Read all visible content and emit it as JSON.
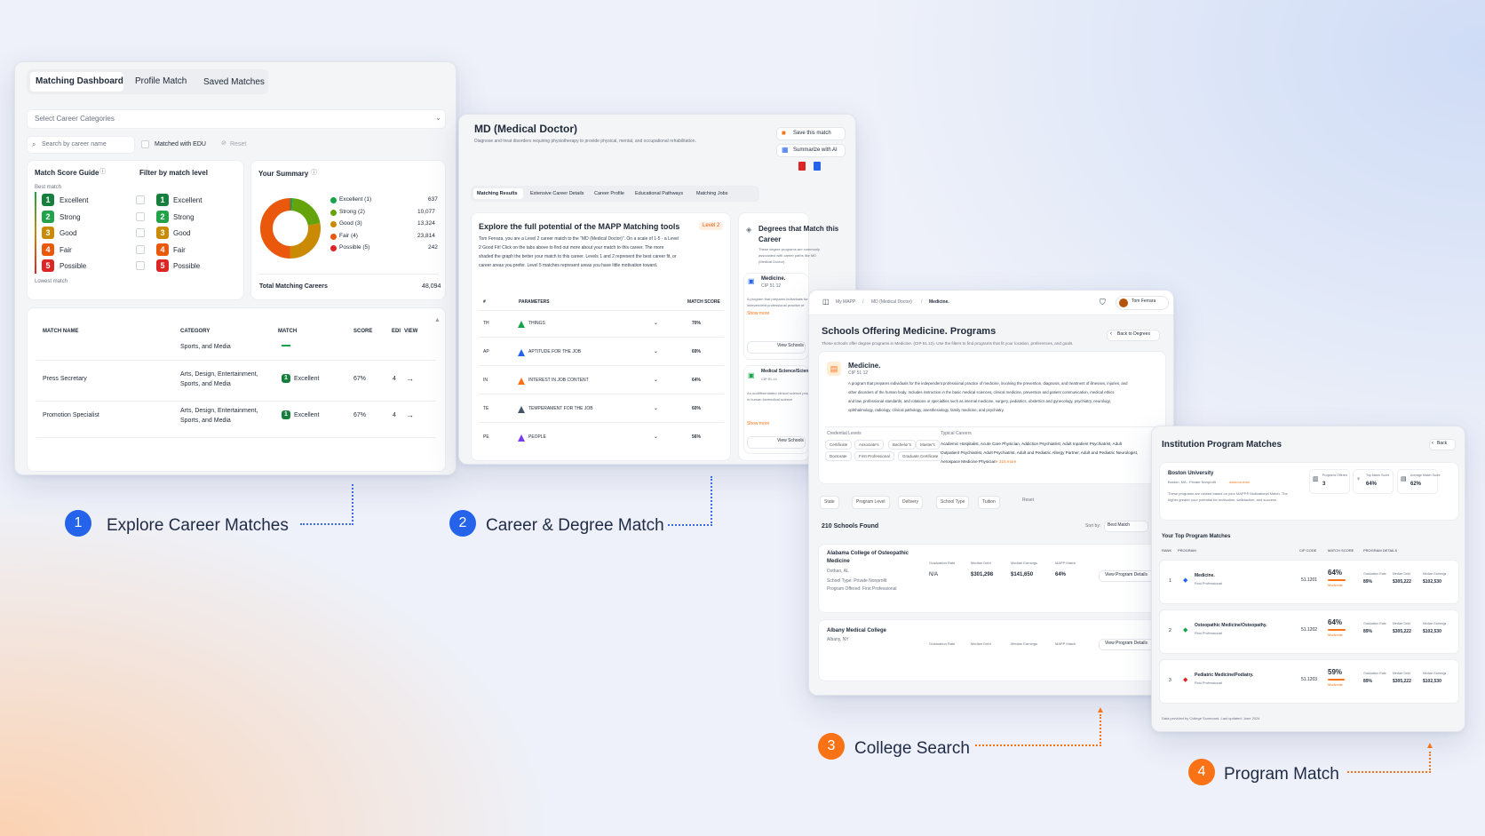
{
  "panel1": {
    "tabs": [
      "Matching Dashboard",
      "Profile Match",
      "Saved Matches"
    ],
    "select_placeholder": "Select Career Categories",
    "search_placeholder": "Search by career name",
    "checkbox_label": "Matched with EDU",
    "reset_label": "Reset",
    "guide_title": "Match Score Guide",
    "guide_top": "Best match",
    "guide_bottom": "Lowest match",
    "filter_title": "Filter by match level",
    "levels": [
      {
        "num": "1",
        "label": "Excellent",
        "color": "#15803d"
      },
      {
        "num": "2",
        "label": "Strong",
        "color": "#22a34a"
      },
      {
        "num": "3",
        "label": "Good",
        "color": "#ca8a04"
      },
      {
        "num": "4",
        "label": "Fair",
        "color": "#ea580c"
      },
      {
        "num": "5",
        "label": "Possible",
        "color": "#dc2626"
      }
    ],
    "summary_title": "Your Summary",
    "summary": [
      {
        "label": "Excellent (1)",
        "value": "637",
        "color": "#16a34a"
      },
      {
        "label": "Strong (2)",
        "value": "10,077",
        "color": "#65a30d"
      },
      {
        "label": "Good (3)",
        "value": "13,324",
        "color": "#ca8a04"
      },
      {
        "label": "Fair (4)",
        "value": "23,814",
        "color": "#ea580c"
      },
      {
        "label": "Possible (5)",
        "value": "242",
        "color": "#dc2626"
      }
    ],
    "total_label": "Total Matching Careers",
    "total_value": "48,094",
    "table_headers": [
      "MATCH NAME",
      "CATEGORY",
      "MATCH",
      "SCORE",
      "EDI",
      "VIEW"
    ],
    "row0_category": "Sports, and Media",
    "rows": [
      {
        "name": "Press Secretary",
        "cat1": "Arts, Design, Entertainment,",
        "cat2": "Sports, and Media",
        "num": "1",
        "match": "Excellent",
        "score": "67%",
        "edu": "4"
      },
      {
        "name": "Promotion Specialist",
        "cat1": "Arts, Design, Entertainment,",
        "cat2": "Sports, and Media",
        "num": "1",
        "match": "Excellent",
        "score": "67%",
        "edu": "4"
      }
    ]
  },
  "panel2": {
    "title": "MD (Medical Doctor)",
    "subtitle": "Diagnose and treat disorders requiring physiotherapy to provide physical, mental, and occupational rehabilitation.",
    "save_label": "Save this match",
    "ai_label": "Summarize with AI",
    "tabs": [
      "Matching Results",
      "Extensive Career Details",
      "Career Profile",
      "Educational Pathways",
      "Matching Jobs"
    ],
    "explore_title": "Explore the full potential of the MAPP Matching tools",
    "level_badge": "Level 2",
    "explore_text": [
      "Tom Ferrara, you are a Level 2 career match to the \"MD (Medical Doctor)\". On a scale of 1-5 - a Level",
      "2 Good Fit! Click on the tabs above to find out more about your match to this career. The more",
      "shaded the graph the better your match to this career. Levels 1 and 2 represent the best career fit, or",
      "career areas you prefer. Level 5 matches represent areas you have little motivation toward."
    ],
    "param_headers": [
      "#",
      "PARAMETERS",
      "MATCH SCORE"
    ],
    "params": [
      {
        "code": "TH",
        "name": "THINGS",
        "score": "70%",
        "color": "#16a34a"
      },
      {
        "code": "AP",
        "name": "APTITUDE FOR THE JOB",
        "score": "69%",
        "color": "#2563eb"
      },
      {
        "code": "IN",
        "name": "INTEREST IN JOB CONTENT",
        "score": "64%",
        "color": "#f97316"
      },
      {
        "code": "TE",
        "name": "TEMPERAMENT FOR THE JOB",
        "score": "60%",
        "color": "#475569"
      },
      {
        "code": "PE",
        "name": "PEOPLE",
        "score": "56%",
        "color": "#7c3aed"
      }
    ],
    "degrees_title1": "Degrees that Match this",
    "degrees_title2": "Career",
    "degrees_desc": [
      "These degree programs are commonly",
      "associated with career paths like MD",
      "(Medical Doctor)."
    ],
    "deg1_name": "Medicine.",
    "deg1_code": "CIP 51.12",
    "deg1_desc": [
      "A program that prepares individuals for",
      "independent professional practice of"
    ],
    "show_more": "Show more",
    "view_schools": "View Schools",
    "deg2_name": "Medical Science/Scientist.",
    "deg2_code": "CIP 51.14",
    "deg2_desc": [
      "An undifferentiated clinical science program",
      "in human biomedical science"
    ]
  },
  "panel3": {
    "breadcrumb": [
      "My MAPP",
      "MD (Medical Doctor)",
      "Medicine."
    ],
    "user": "Tom Ferrara",
    "title": "Schools Offering Medicine. Programs",
    "back": "Back to Degrees",
    "subtitle": "These schools offer degree programs in Medicine. (CIP 51.12). Use the filters to find programs that fit your location, preferences, and goals.",
    "program_name": "Medicine.",
    "program_code": "CIP 51.12",
    "program_desc": [
      "A program that prepares individuals for the independent professional practice of medicine, involving the prevention, diagnosis, and treatment of illnesses, injuries, and",
      "other disorders of the human body. Includes instruction in the basic medical sciences, clinical medicine, prevention and patient communication, medical ethics",
      "and law, professional standards, and rotations or specialties such as internal medicine, surgery, pediatrics, obstetrics and gynecology, psychiatry, neurology,",
      "ophthalmology, radiology, clinical pathology, anesthesiology, family medicine, and psychiatry."
    ],
    "cred_title": "Credential Levels",
    "creds": [
      "Certificate",
      "Associate's",
      "Bachelor's",
      "Master's",
      "Doctorate",
      "First Professional",
      "Graduate Certificate"
    ],
    "careers_title": "Typical Careers",
    "careers": [
      "Academic Hospitalist, Acute Care Physician, Addiction Psychiatrist, Adult Inpatient Psychiatrist, Adult",
      "Outpatient Psychiatrist, Adult Psychiatrist, Adult and Pediatric Allergy Partner, Adult and Pediatric Neurologist,",
      "Aerospace Medicine Physician"
    ],
    "careers_more": "+ 215 more",
    "filters": [
      "State",
      "Program Level",
      "Delivery",
      "School Type",
      "Tuition"
    ],
    "reset": "Reset",
    "found": "210 Schools Found",
    "sort_label": "Sort by:",
    "sort_value": "Best Match",
    "school1": {
      "name1": "Alabama College of Osteopathic",
      "name2": "Medicine",
      "loc": "Dothan, AL",
      "type": "School Type: Private Nonprofit",
      "offered": "Program Offered: First Professional",
      "grad_label": "Graduation Rate",
      "grad": "N/A",
      "debt_label": "Median Debt",
      "debt": "$301,298",
      "earn_label": "Median Earnings",
      "earn": "$141,650",
      "mapp_label": "MAPP Match",
      "mapp": "64%"
    },
    "school2": {
      "name": "Albany Medical College",
      "loc": "Albany, NY",
      "grad_label": "Graduation Rate",
      "debt_label": "Median Debt",
      "earn_label": "Median Earnings",
      "mapp_label": "MAPP Match"
    },
    "view_details": "View Program Details"
  },
  "panel4": {
    "title": "Institution Program Matches",
    "back": "Back",
    "inst_name": "Boston University",
    "inst_loc": "Boston, MA - Private Nonprofit",
    "inst_link": "www.bu.edu/",
    "inst_desc": [
      "These programs are ranked based on your MAPP® Motivational Match. The",
      "higher greater your potential for motivation, satisfaction, and success."
    ],
    "stats": [
      {
        "label": "Programs Offered",
        "value": "3"
      },
      {
        "label": "Top Match Score",
        "value": "64%"
      },
      {
        "label": "Average Match Score",
        "value": "62%"
      }
    ],
    "top_title": "Your Top Program Matches",
    "headers": [
      "RANK",
      "PROGRAM",
      "CIP CODE",
      "MATCH SCORE",
      "PROGRAM DETAILS"
    ],
    "programs": [
      {
        "rank": "1",
        "name": "Medicine.",
        "level": "First Professional",
        "cip": "51.1201",
        "score": "64%",
        "match": "Moderate",
        "grad": "89%",
        "debt": "$305,222",
        "earn": "$102,530",
        "color": "#2563eb"
      },
      {
        "rank": "2",
        "name": "Osteopathic Medicine/Osteopathy.",
        "level": "First Professional",
        "cip": "51.1202",
        "score": "64%",
        "match": "Moderate",
        "grad": "89%",
        "debt": "$305,222",
        "earn": "$102,530",
        "color": "#16a34a"
      },
      {
        "rank": "3",
        "name": "Pediatric Medicine/Podiatry.",
        "level": "First Professional",
        "cip": "51.1203",
        "score": "59%",
        "match": "Moderate",
        "grad": "89%",
        "debt": "$305,222",
        "earn": "$102,530",
        "color": "#dc2626"
      }
    ],
    "col_labels": [
      "Graduation Rate",
      "Median Debt",
      "Median Earnings"
    ],
    "footer": "Data provided by College Scorecard. Last updated: June 2024"
  },
  "steps": [
    {
      "num": "1",
      "label": "Explore Career Matches",
      "color": "#2563eb"
    },
    {
      "num": "2",
      "label": "Career & Degree Match",
      "color": "#2563eb"
    },
    {
      "num": "3",
      "label": "College Search",
      "color": "#f97316"
    },
    {
      "num": "4",
      "label": "Program Match",
      "color": "#f97316"
    }
  ],
  "donut": {
    "values": [
      637,
      10077,
      13324,
      23814,
      242
    ],
    "colors": [
      "#16a34a",
      "#65a30d",
      "#ca8a04",
      "#ea580c",
      "#dc2626"
    ]
  }
}
